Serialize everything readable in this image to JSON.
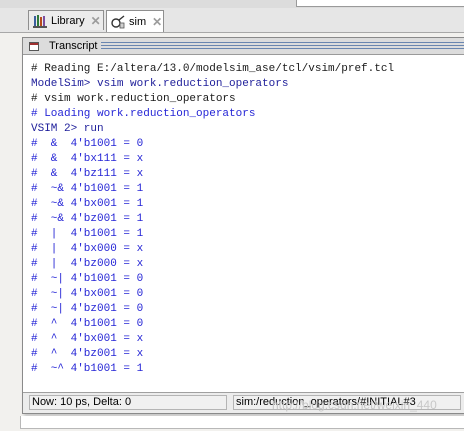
{
  "tabs": [
    {
      "label": "Library",
      "icon": "library-icon",
      "active": false
    },
    {
      "label": "sim",
      "icon": "sim-icon",
      "active": true
    }
  ],
  "transcript": {
    "title": "Transcript",
    "lines": [
      {
        "text": "# Reading E:/altera/13.0/modelsim_ase/tcl/vsim/pref.tcl",
        "color": "#1a1a1a"
      },
      {
        "text": "ModelSim> vsim work.reduction_operators",
        "color": "#1e1e9a"
      },
      {
        "text": "# vsim work.reduction_operators",
        "color": "#1a1a1a"
      },
      {
        "text": "# Loading work.reduction_operators",
        "color": "#2525d6"
      },
      {
        "text": "VSIM 2> run",
        "color": "#1e1e9a"
      },
      {
        "text": "#  &  4'b1001 = 0",
        "color": "#2525d6"
      },
      {
        "text": "#  &  4'bx111 = x",
        "color": "#2525d6"
      },
      {
        "text": "#  &  4'bz111 = x",
        "color": "#2525d6"
      },
      {
        "text": "#  ~& 4'b1001 = 1",
        "color": "#2525d6"
      },
      {
        "text": "#  ~& 4'bx001 = 1",
        "color": "#2525d6"
      },
      {
        "text": "#  ~& 4'bz001 = 1",
        "color": "#2525d6"
      },
      {
        "text": "#  |  4'b1001 = 1",
        "color": "#2525d6"
      },
      {
        "text": "#  |  4'bx000 = x",
        "color": "#2525d6"
      },
      {
        "text": "#  |  4'bz000 = x",
        "color": "#2525d6"
      },
      {
        "text": "#  ~| 4'b1001 = 0",
        "color": "#2525d6"
      },
      {
        "text": "#  ~| 4'bx001 = 0",
        "color": "#2525d6"
      },
      {
        "text": "#  ~| 4'bz001 = 0",
        "color": "#2525d6"
      },
      {
        "text": "#  ^  4'b1001 = 0",
        "color": "#2525d6"
      },
      {
        "text": "#  ^  4'bx001 = x",
        "color": "#2525d6"
      },
      {
        "text": "#  ^  4'bz001 = x",
        "color": "#2525d6"
      },
      {
        "text": "#  ~^ 4'b1001 = 1",
        "color": "#2525d6"
      }
    ]
  },
  "status": {
    "now": "Now: 10 ps",
    "delta": "Delta: 0",
    "path": "sim:/reduction_operators/#INITIAL#3"
  },
  "watermark": "http://blog.csdn.net/weixin_440"
}
